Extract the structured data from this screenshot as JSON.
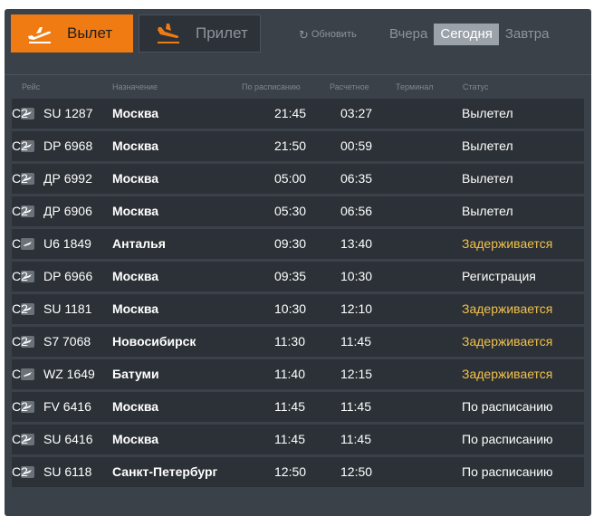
{
  "tabs": {
    "departure": "Вылет",
    "arrival": "Прилет"
  },
  "refresh_label": "Обновить",
  "days": [
    "Вчера",
    "Сегодня",
    "Завтра"
  ],
  "active_day_index": 1,
  "columns": {
    "flight": "Рейс",
    "destination": "Назначение",
    "scheduled": "По расписанию",
    "estimated": "Расчетное",
    "terminal": "Терминал",
    "status": "Статус"
  },
  "colors": {
    "accent": "#f07b12",
    "delayed": "#f2c14e"
  },
  "flights": [
    {
      "logo": "aeroflot-logo",
      "flight": "SU 1287",
      "destination": "Москва",
      "scheduled": "21:45",
      "estimated": "03:27",
      "terminal": "C2",
      "status": "Вылетел",
      "delayed": false
    },
    {
      "logo": "pobeda-logo",
      "flight": "DP 6968",
      "destination": "Москва",
      "scheduled": "21:50",
      "estimated": "00:59",
      "terminal": "C2",
      "status": "Вылетел",
      "delayed": false
    },
    {
      "logo": "pobeda-logo",
      "flight": "ДР 6992",
      "destination": "Москва",
      "scheduled": "05:00",
      "estimated": "06:35",
      "terminal": "C2",
      "status": "Вылетел",
      "delayed": false
    },
    {
      "logo": "pobeda-logo",
      "flight": "ДР 6906",
      "destination": "Москва",
      "scheduled": "05:30",
      "estimated": "06:56",
      "terminal": "C2",
      "status": "Вылетел",
      "delayed": false
    },
    {
      "logo": "ural-logo",
      "flight": "U6 1849",
      "destination": "Анталья",
      "scheduled": "09:30",
      "estimated": "13:40",
      "terminal": "C",
      "status": "Задерживается",
      "delayed": true
    },
    {
      "logo": "pobeda-logo",
      "flight": "DP 6966",
      "destination": "Москва",
      "scheduled": "09:35",
      "estimated": "10:30",
      "terminal": "C2",
      "status": "Регистрация",
      "delayed": false
    },
    {
      "logo": "aeroflot-logo",
      "flight": "SU 1181",
      "destination": "Москва",
      "scheduled": "10:30",
      "estimated": "12:10",
      "terminal": "C2",
      "status": "Задерживается",
      "delayed": true
    },
    {
      "logo": "s7-logo",
      "flight": "S7 7068",
      "destination": "Новосибирск",
      "scheduled": "11:30",
      "estimated": "11:45",
      "terminal": "C2",
      "status": "Задерживается",
      "delayed": true
    },
    {
      "logo": "wizz-logo",
      "flight": "WZ 1649",
      "destination": "Батуми",
      "scheduled": "11:40",
      "estimated": "12:15",
      "terminal": "C",
      "status": "Задерживается",
      "delayed": true
    },
    {
      "logo": "rossiya-logo",
      "flight": "FV 6416",
      "destination": "Москва",
      "scheduled": "11:45",
      "estimated": "11:45",
      "terminal": "C2",
      "status": "По расписанию",
      "delayed": false
    },
    {
      "logo": "aeroflot-logo",
      "flight": "SU 6416",
      "destination": "Москва",
      "scheduled": "11:45",
      "estimated": "11:45",
      "terminal": "C2",
      "status": "По расписанию",
      "delayed": false
    },
    {
      "logo": "aeroflot-logo",
      "flight": "SU 6118",
      "destination": "Санкт-Петербург",
      "scheduled": "12:50",
      "estimated": "12:50",
      "terminal": "C2",
      "status": "По расписанию",
      "delayed": false
    }
  ]
}
